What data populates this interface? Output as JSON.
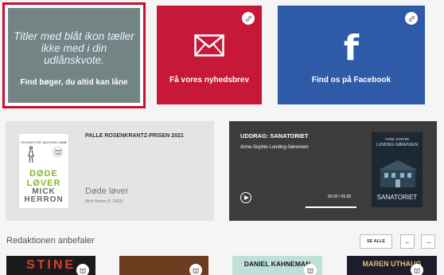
{
  "tiles": {
    "loan": {
      "note": "Titler med blåt ikon tæller ikke med i din udlånskvote.",
      "label": "Find bøger, du altid kan låne"
    },
    "newsletter": {
      "label": "Få vores nyhedsbrev",
      "icon": "envelope-icon"
    },
    "facebook": {
      "label": "Find os på Facebook",
      "icon": "facebook-icon"
    }
  },
  "prize_card": {
    "heading": "PALLE ROSENKRANTZ-PRISEN 2021",
    "title": "Døde løver",
    "author": "Mick Herron (f. 1963)",
    "cover": {
      "top_text": "EN BOG FOR JACKSON LAMB",
      "title": "DØDE LØVER",
      "author": "MICK HERRON"
    }
  },
  "excerpt_card": {
    "heading": "UDDRAG: SANATORIET",
    "author": "Anne-Sophie Lunding-Sørensen",
    "time": "00.00 / 05.00",
    "cover": {
      "author": "ANNE SOPHIE",
      "author2": "LUNDING-SØRENSEN",
      "title": "SANATORIET"
    }
  },
  "section": {
    "title": "Redaktionen anbefaler",
    "see_all": "SE ALLE",
    "prev": "←",
    "next": "→"
  },
  "books": [
    {
      "text": "STINE",
      "bg": "#1a1a1a",
      "fg": "#d5402d"
    },
    {
      "text": "",
      "bg": "#6b3d1e",
      "fg": "#ffffff"
    },
    {
      "text": "DANIEL KAHNEMAN",
      "bg": "#bfe0d8",
      "fg": "#1a1a1a"
    },
    {
      "text": "MAREN UTHAUG",
      "bg": "#1c1c2a",
      "fg": "#e3c16a"
    }
  ],
  "colors": {
    "accent_red": "#c8183a",
    "facebook_blue": "#2f5aa8",
    "loan_gray": "#728484"
  }
}
